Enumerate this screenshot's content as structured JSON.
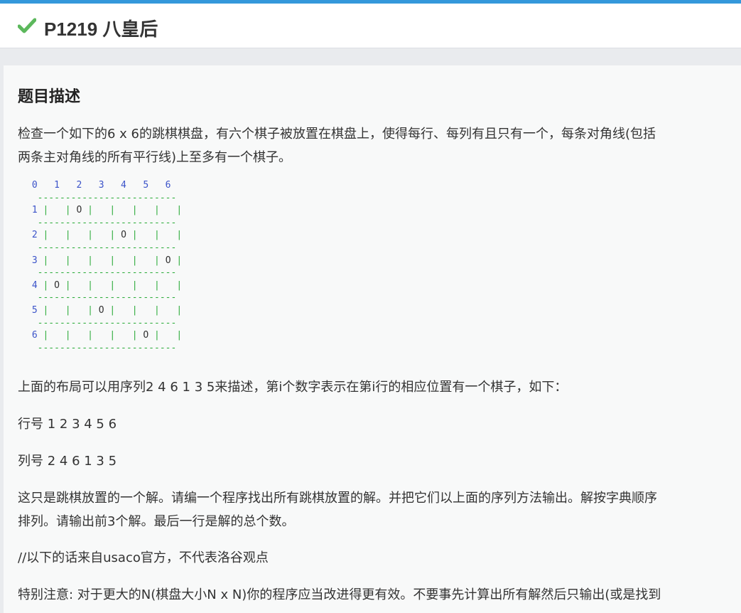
{
  "header": {
    "problem_id": "P1219",
    "problem_title": "八皇后",
    "title_text": "P1219 八皇后",
    "status_icon": "check-icon",
    "status_color": "#5cb85c",
    "accent_color": "#3498db"
  },
  "section": {
    "title": "题目描述"
  },
  "paragraphs": {
    "p1": "检查一个如下的6 x 6的跳棋棋盘，有六个棋子被放置在棋盘上，使得每行、每列有且只有一个，每条对角线(包括\n两条主对角线的所有平行线)上至多有一个棋子。",
    "p2": "上面的布局可以用序列2 4 6 1 3 5来描述，第i个数字表示在第i行的相应位置有一个棋子，如下：",
    "p3": "行号 1 2 3 4 5 6",
    "p4": "列号 2 4 6 1 3 5",
    "p5": "这只是跳棋放置的一个解。请编一个程序找出所有跳棋放置的解。并把它们以上面的序列方法输出。解按字典顺序\n排列。请输出前3个解。最后一行是解的总个数。",
    "p6": "//以下的话来自usaco官方，不代表洛谷观点",
    "p7": "特别注意: 对于更大的N(棋盘大小N x N)你的程序应当改进得更有效。不要事先计算出所有解然后只输出(或是找到"
  },
  "board": {
    "header_row": " 0   1   2   3   4   5   6",
    "separator": "  -------------------------",
    "rows": [
      {
        "label": "1",
        "cells": "|   | O |   |   |   |   |"
      },
      {
        "label": "2",
        "cells": "|   |   |   | O |   |   |"
      },
      {
        "label": "3",
        "cells": "|   |   |   |   |   | O |"
      },
      {
        "label": "4",
        "cells": "| O |   |   |   |   |   |"
      },
      {
        "label": "5",
        "cells": "|   |   | O |   |   |   |"
      },
      {
        "label": "6",
        "cells": "|   |   |   |   | O |   |"
      }
    ]
  }
}
